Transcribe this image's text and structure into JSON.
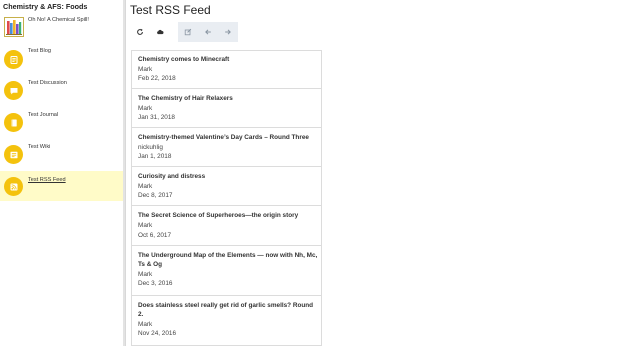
{
  "sidebar": {
    "title": "Chemistry & AFS: Foods",
    "items": [
      {
        "label": "Oh No! A Chemical Spill!",
        "icon": "books-thumbnail-icon",
        "active": false
      },
      {
        "label": "Test Blog",
        "icon": "blog-icon",
        "active": false
      },
      {
        "label": "Test Discussion",
        "icon": "discussion-icon",
        "active": false
      },
      {
        "label": "Test Journal",
        "icon": "journal-icon",
        "active": false
      },
      {
        "label": "Test Wiki",
        "icon": "wiki-icon",
        "active": false
      },
      {
        "label": "Test RSS Feed",
        "icon": "rss-icon",
        "active": true
      }
    ]
  },
  "main": {
    "title": "Test RSS Feed",
    "toolbar": {
      "icons": [
        "refresh-icon",
        "cloud-icon",
        "edit-icon",
        "arrow-left-icon",
        "arrow-right-icon"
      ]
    }
  },
  "feed": {
    "items": [
      {
        "title": "Chemistry comes to Minecraft",
        "author": "Mark",
        "date": "Feb 22, 2018"
      },
      {
        "title": "The Chemistry of Hair Relaxers",
        "author": "Mark",
        "date": "Jan 31, 2018"
      },
      {
        "title": "Chemistry-themed Valentine’s Day Cards – Round Three",
        "author": "nickuhlig",
        "date": "Jan 1, 2018"
      },
      {
        "title": "Curiosity and distress",
        "author": "Mark",
        "date": "Dec 8, 2017"
      },
      {
        "title": "The Secret Science of Superheroes—the origin story",
        "author": "Mark",
        "date": "Oct 6, 2017"
      },
      {
        "title": "The Underground Map of the Elements — now with Nh, Mc, Ts & Og",
        "author": "Mark",
        "date": "Dec 3, 2016"
      },
      {
        "title": "Does stainless steel really get rid of garlic smells? Round 2.",
        "author": "Mark",
        "date": "Nov 24, 2016"
      }
    ]
  },
  "colors": {
    "accent": "#f4c20d",
    "active_bg": "#fffbc8",
    "toolbar_group_bg": "#e9edf2"
  }
}
